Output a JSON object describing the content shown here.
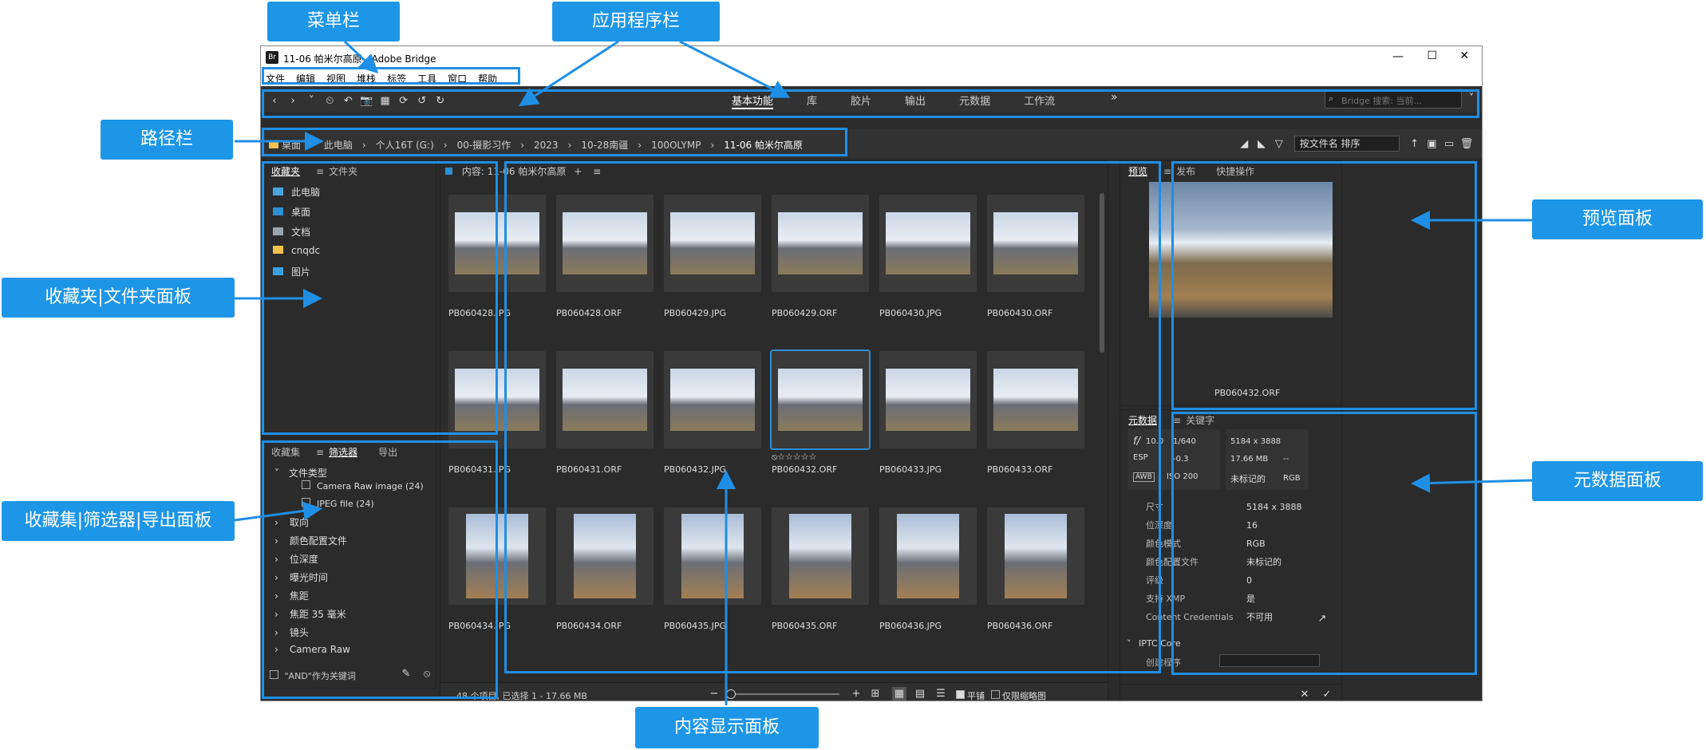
{
  "annotations": {
    "menubar": "菜单栏",
    "appbar": "应用程序栏",
    "pathbar": "路径栏",
    "favorites_panel": "收藏夹|文件夹面板",
    "collections_panel": "收藏集|筛选器|导出面板",
    "content_panel": "内容显示面板",
    "preview_panel": "预览面板",
    "metadata_panel": "元数据面板"
  },
  "window": {
    "icon_label": "Br",
    "title": "11-06 帕米尔高原 - Adobe Bridge",
    "controls": [
      "—",
      "☐",
      "✕"
    ]
  },
  "menu": [
    "文件",
    "编辑",
    "视图",
    "堆栈",
    "标签",
    "工具",
    "窗口",
    "帮助"
  ],
  "workspaces": {
    "items": [
      "基本功能",
      "库",
      "胶片",
      "输出",
      "元数据",
      "工作流"
    ],
    "active": "基本功能",
    "more": "»"
  },
  "search": {
    "placeholder": "Bridge 搜索: 当前..."
  },
  "path": {
    "items": [
      "桌面",
      "此电脑",
      "个人16T (G:)",
      "00-摄影习作",
      "2023",
      "10-28南疆",
      "100OLYMP",
      "11-06 帕米尔高原"
    ]
  },
  "sort": {
    "label": "按文件名 排序"
  },
  "favorites": {
    "tabs": [
      "收藏夹",
      "文件夹"
    ],
    "items": [
      {
        "label": "此电脑",
        "icon": "computer-icon",
        "color": "#4aa3df"
      },
      {
        "label": "桌面",
        "icon": "desktop-icon",
        "color": "#2d8fd6"
      },
      {
        "label": "文档",
        "icon": "documents-icon",
        "color": "#9aa4ae"
      },
      {
        "label": "cnqdc",
        "icon": "folder-icon",
        "color": "#f2c14e"
      },
      {
        "label": "图片",
        "icon": "pictures-icon",
        "color": "#3aa0e0"
      }
    ]
  },
  "collections": {
    "tabs": [
      "收藏集",
      "筛选器",
      "导出"
    ],
    "active": "筛选器",
    "filetype_header": "文件类型",
    "filetypes": [
      "Camera Raw image (24)",
      "JPEG file (24)"
    ],
    "groups": [
      "取向",
      "颜色配置文件",
      "位深度",
      "曝光时间",
      "焦距",
      "焦距 35 毫米",
      "镜头",
      "Camera Raw"
    ],
    "footer": "\"AND\"作为关键词"
  },
  "content": {
    "header": "内容: 11-06 帕米尔高原",
    "status": "48 个项目, 已选择 1 - 17.66 MB",
    "selected_index": 9,
    "rating": "⦸☆☆☆☆☆",
    "thumbs": [
      {
        "name": "PB060428.JPG",
        "orient": "land"
      },
      {
        "name": "PB060428.ORF",
        "orient": "land"
      },
      {
        "name": "PB060429.JPG",
        "orient": "land"
      },
      {
        "name": "PB060429.ORF",
        "orient": "land"
      },
      {
        "name": "PB060430.JPG",
        "orient": "land"
      },
      {
        "name": "PB060430.ORF",
        "orient": "land"
      },
      {
        "name": "PB060431.JPG",
        "orient": "land"
      },
      {
        "name": "PB060431.ORF",
        "orient": "land"
      },
      {
        "name": "PB060432.JPG",
        "orient": "land"
      },
      {
        "name": "PB060432.ORF",
        "orient": "land"
      },
      {
        "name": "PB060433.JPG",
        "orient": "land"
      },
      {
        "name": "PB060433.ORF",
        "orient": "land"
      },
      {
        "name": "PB060434.JPG",
        "orient": "portrait"
      },
      {
        "name": "PB060434.ORF",
        "orient": "portrait"
      },
      {
        "name": "PB060435.JPG",
        "orient": "portrait"
      },
      {
        "name": "PB060435.ORF",
        "orient": "portrait"
      },
      {
        "name": "PB060436.JPG",
        "orient": "portrait"
      },
      {
        "name": "PB060436.ORF",
        "orient": "portrait"
      }
    ],
    "footer_options": [
      "平铺",
      "仅限缩略图"
    ]
  },
  "preview": {
    "tabs": [
      "预览",
      "发布",
      "快捷操作"
    ],
    "filename": "PB060432.ORF"
  },
  "metadata": {
    "tabs": [
      "元数据",
      "关键字"
    ],
    "camera": {
      "aperture": "10.0",
      "shutter": "1/640",
      "ev": "-0.3",
      "iso": "ISO 200",
      "awb": "AWB",
      "esp": "ESP",
      "dims": "5184 x 3888",
      "size": "17.66 MB",
      "dash": "--",
      "profile": "未标记的",
      "mode": "RGB"
    },
    "rows": [
      {
        "k": "尺寸",
        "v": "5184 x 3888"
      },
      {
        "k": "位深度",
        "v": "16"
      },
      {
        "k": "颜色模式",
        "v": "RGB"
      },
      {
        "k": "颜色配置文件",
        "v": "未标记的"
      },
      {
        "k": "评级",
        "v": "0"
      },
      {
        "k": "支持 XMP",
        "v": "是"
      },
      {
        "k": "Content Credentials",
        "v": "不可用"
      }
    ],
    "section": "IPTC Core",
    "partial_row": "创建程序"
  }
}
